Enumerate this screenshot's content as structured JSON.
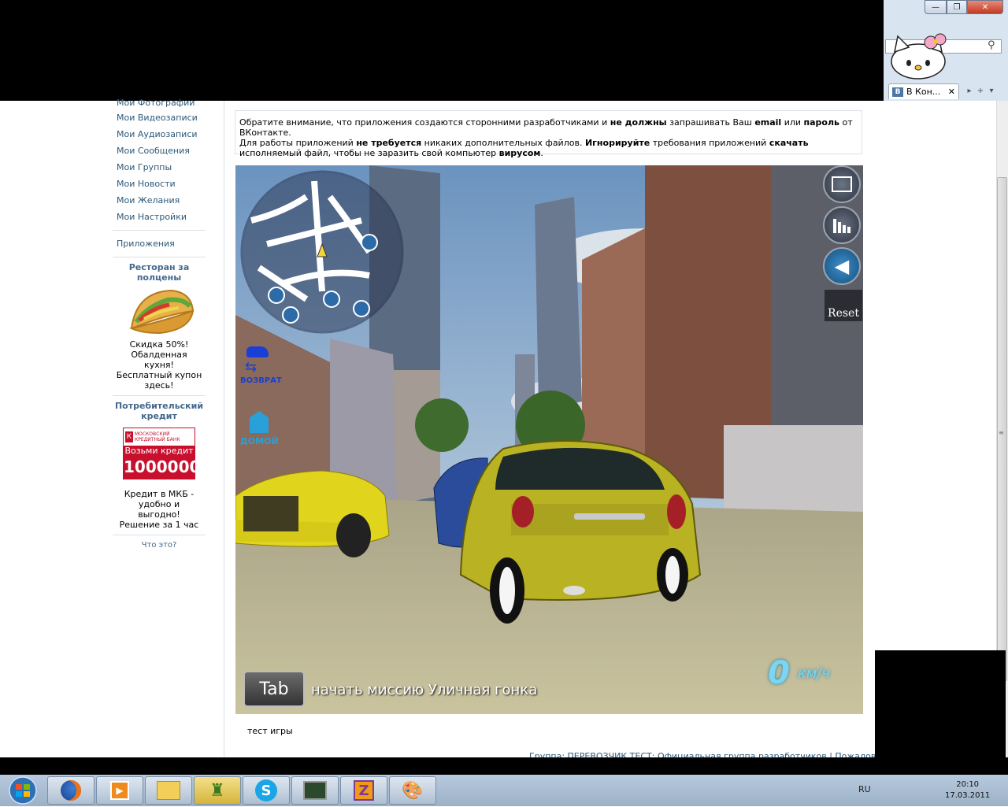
{
  "browser": {
    "tab_title": "В Кон...",
    "tab_close": "✕",
    "window_min": "—",
    "window_max": "❐",
    "window_close": "✕"
  },
  "nav": {
    "items": [
      {
        "label": "Мои Фотографии"
      },
      {
        "label": "Мои Видеозаписи"
      },
      {
        "label": "Мои Аудиозаписи"
      },
      {
        "label": "Мои Сообщения"
      },
      {
        "label": "Мои Группы"
      },
      {
        "label": "Мои Новости"
      },
      {
        "label": "Мои Желания"
      },
      {
        "label": "Мои Настройки"
      }
    ],
    "apps": "Приложения"
  },
  "ads": {
    "ad1_title": "Ресторан за полцены",
    "ad1_text": "Скидка 50%! Обалденная кухня! Бесплатный купон здесь!",
    "ad2_title": "Потребительский кредит",
    "ad2_bank": "МОСКОВСКИЙ КРЕДИТНЫЙ БАНК",
    "ad2_banner_line1": "Возьми кредит",
    "ad2_banner_line2": "1000000",
    "ad2_text": "Кредит в МКБ - удобно и выгодно! Решение за 1 час",
    "what_is_this": "Что это?"
  },
  "notice": {
    "p1": "Обратите внимание, что приложения создаются сторонними разработчиками и ",
    "b1": "не должны",
    "p2": " запрашивать Ваш ",
    "b2": "email",
    "p3": " или ",
    "b3": "пароль",
    "p4": " от ВКонтакте.",
    "p5": "Для работы приложений ",
    "b4": "не требуется",
    "p6": " никаких дополнительных файлов. ",
    "b5": "Игнорируйте",
    "p7": " требования приложений ",
    "b6": "скачать",
    "p8": " исполняемый файл, чтобы не заразить свой компьютер ",
    "b7": "вирусом",
    "p9": "."
  },
  "game": {
    "reset": "Reset",
    "return_label": "ВОЗВРАТ",
    "home_label": "ДОМОЙ",
    "tab_key": "Tab",
    "mission_text": "начать миссию Уличная гонка",
    "speed_value": "0",
    "speed_unit": "км/ч"
  },
  "caption": "тест игры",
  "footer": "Группа: ПЕРЕВОЗЧИК ТЕСТ: Официальная группа разработчиков | Пожаловаться",
  "taskbar": {
    "lang": "RU",
    "time": "20:10",
    "date": "17.03.2011"
  }
}
